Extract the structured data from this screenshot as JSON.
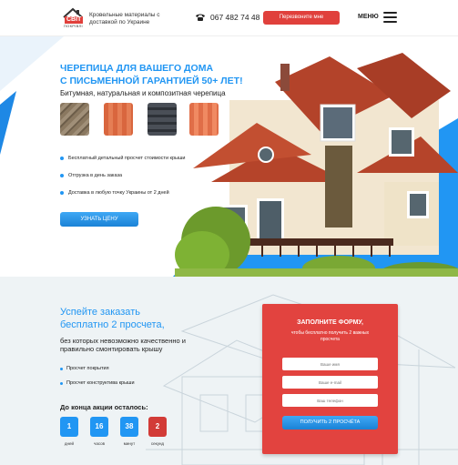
{
  "header": {
    "logo_text": "СВІТ",
    "logo_sub": "ПОКРІВЛІ",
    "tagline": "Кровельные материалы с доставкой по Украине",
    "phone": "067 482 74 48",
    "callback_label": "Перезвоните мне",
    "menu_label": "МЕНЮ"
  },
  "hero": {
    "title_line1": "ЧЕРЕПИЦА ДЛЯ ВАШЕГО ДОМА",
    "title_line2": "С ПИСЬМЕННОЙ ГАРАНТИЕЙ 50+ ЛЕТ!",
    "subtitle": "Битумная, натуральная и композитная черепица",
    "features": [
      "Бесплатный детальный просчет стоимости крыши",
      "Отгрузка в день заказа",
      "Доставка в любую точку Украины от 2 дней"
    ],
    "cta_label": "УЗНАТЬ ЦЕНУ"
  },
  "promo": {
    "title_line1": "Успейте заказать",
    "title_line2": "бесплатно 2 просчета,",
    "text": "без которых невозможно качественно и правильно смонтировать крышу",
    "checks": [
      "Просчет покрытия",
      "Просчет конструктива крыши"
    ],
    "timer_title": "До конца акции осталось:",
    "timer": [
      {
        "value": "1",
        "label": "дней"
      },
      {
        "value": "16",
        "label": "часов"
      },
      {
        "value": "38",
        "label": "минут"
      },
      {
        "value": "2",
        "label": "секунд"
      }
    ]
  },
  "form": {
    "title": "ЗАПОЛНИТЕ ФОРМУ,",
    "subtitle": "чтобы бесплатно получить 2 важных просчета",
    "name_placeholder": "Ваше имя",
    "email_placeholder": "Ваше e-mail",
    "phone_placeholder": "Ваш телефон",
    "submit_label": "ПОЛУЧИТЬ 2 ПРОСЧЁТА"
  },
  "colors": {
    "accent": "#2196f3",
    "brand_red": "#e0403c",
    "timer_red": "#d23b37"
  }
}
